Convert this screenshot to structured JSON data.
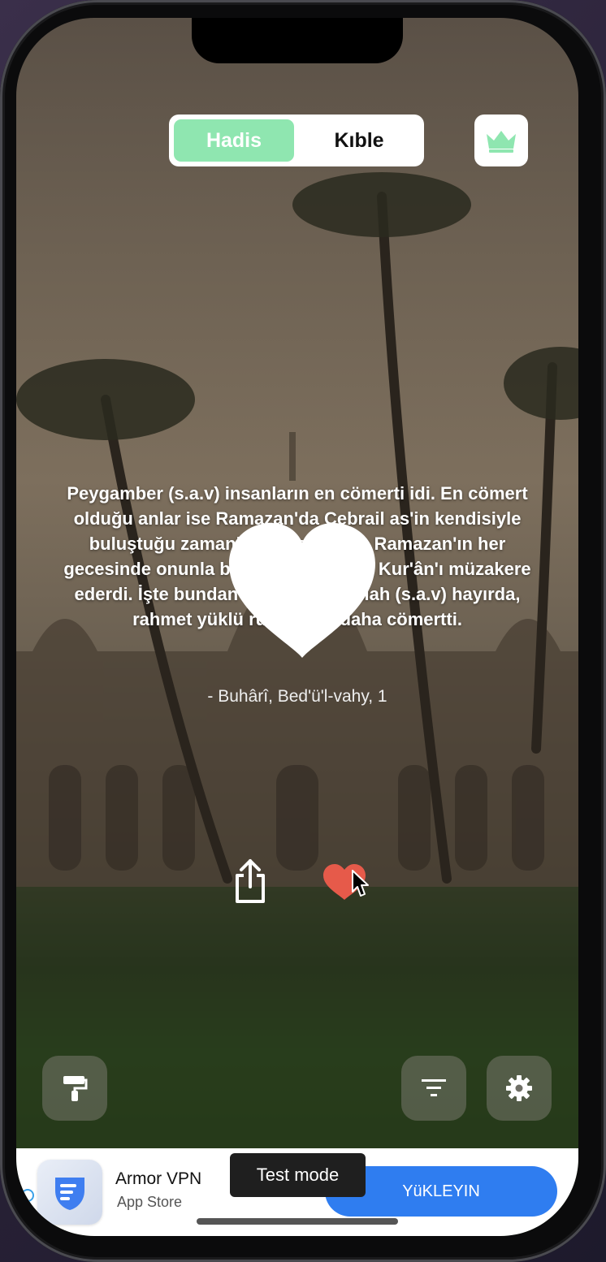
{
  "tabs": [
    {
      "label": "Hadis",
      "active": true
    },
    {
      "label": "Kıble",
      "active": false
    }
  ],
  "accent_color": "#8fe6b0",
  "icons": {
    "premium": "crown-icon",
    "share": "share-icon",
    "like": "heart-icon",
    "brush": "paint-roller-icon",
    "filter": "filter-icon",
    "settings": "gear-icon"
  },
  "hadith": {
    "text": "Peygamber (s.a.v) insanların en cömerti idi. En cömert olduğu anlar ise Ramazan'da Cebrail as'in kendisiyle buluştuğu zamanlardı. Cebrail as Ramazan'ın her gecesinde onunla buluşur ve onunla Kur'ân'ı müzakere ederdi. İşte bundan dolayı Resulullah (s.a.v) hayırda, rahmet yüklü rüzgârdan daha cömertti.",
    "source": "- Buhârî, Bed'ü'l-vahy, 1"
  },
  "ad": {
    "app_name": "Armor VPN",
    "store": "App Store",
    "install_label": "YüKLEYIN",
    "badge": "Test mode",
    "button_color": "#2f7df0"
  }
}
